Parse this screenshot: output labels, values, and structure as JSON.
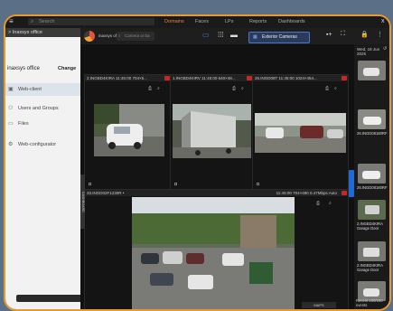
{
  "topbar": {
    "search_placeholder": "Search",
    "tabs": [
      "Domains",
      "Faces",
      "LPs",
      "Reports",
      "Dashboards"
    ],
    "active_tab": "Domains",
    "close": "x"
  },
  "leftpane": {
    "breadcrumb": "> Inaxsys office",
    "org_name": "inaxsys office",
    "change": "Change",
    "nav": [
      {
        "icon": "▣",
        "label": "Web-client"
      },
      {
        "icon": "⚇",
        "label": "Users and Groups"
      },
      {
        "icon": "▭",
        "label": "Files"
      },
      {
        "icon": "⚙",
        "label": "Web-configurator"
      }
    ]
  },
  "client": {
    "org_name": "inaxsys office",
    "search_placeholder": "Camera or ba",
    "camera_group": "Exterior Cameras",
    "tiles": [
      {
        "header": "2.INGBD4KIRA 11:45:00  704×5..."
      },
      {
        "header": "1.INGBD4KIRV 11:45:00  640×48..."
      },
      {
        "header": "26.INGD08T 11:45:00  1024×454..."
      },
      {
        "header": "33.INGD02F1230R  •"
      }
    ],
    "big_tile_right": "11:45:00  704×480 0.47Mbps Auto",
    "dashboard_tab": "DASHBOARD",
    "maps": "MAPS"
  },
  "sidebar": {
    "date": "Wed, 18 Jun 2025",
    "events": [
      {
        "label": ""
      },
      {
        "label": "26.INGD08180RF"
      },
      {
        "label": "26.INGD08180RF"
      },
      {
        "label": "2.INGBD4KIRA Garage Door"
      },
      {
        "label": "2.INGBD4KIRA Garage Door"
      },
      {
        "label": ""
      }
    ],
    "recent": "Recent 100/100 events"
  }
}
